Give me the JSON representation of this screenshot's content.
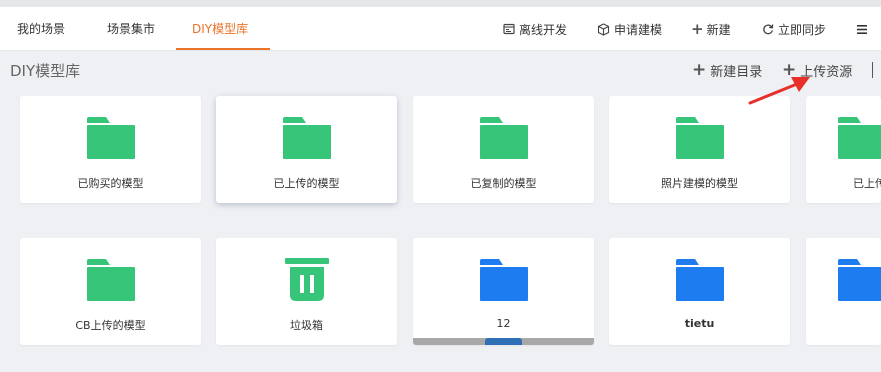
{
  "tabs": [
    {
      "label": "我的场景",
      "active": false
    },
    {
      "label": "场景集市",
      "active": false
    },
    {
      "label": "DIY模型库",
      "active": true
    }
  ],
  "toolbar": {
    "offline_dev": "离线开发",
    "apply_modeling": "申请建模",
    "new": "新建",
    "sync_now": "立即同步"
  },
  "page_title": "DIY模型库",
  "actions": {
    "new_directory": "新建目录",
    "upload_resource": "上传资源"
  },
  "folders": [
    {
      "label": "已购买的模型",
      "color": "#37c57a",
      "type": "folder"
    },
    {
      "label": "已上传的模型",
      "color": "#37c57a",
      "type": "folder"
    },
    {
      "label": "已复制的模型",
      "color": "#37c57a",
      "type": "folder"
    },
    {
      "label": "照片建模的模型",
      "color": "#37c57a",
      "type": "folder"
    },
    {
      "label": "已上传",
      "color": "#37c57a",
      "type": "folder"
    },
    {
      "label": "CB上传的模型",
      "color": "#37c57a",
      "type": "folder"
    },
    {
      "label": "垃圾箱",
      "color": "#37c57a",
      "type": "trash"
    },
    {
      "label": "12",
      "color": "#1c7cf0",
      "type": "folder"
    },
    {
      "label": "tietu",
      "color": "#1c7cf0",
      "type": "folder"
    },
    {
      "label": "",
      "color": "#1c7cf0",
      "type": "folder"
    }
  ],
  "colors": {
    "accent": "#e8732a",
    "folder_green": "#37c57a",
    "folder_blue": "#1c7cf0",
    "annotation_arrow": "#e8302a"
  }
}
